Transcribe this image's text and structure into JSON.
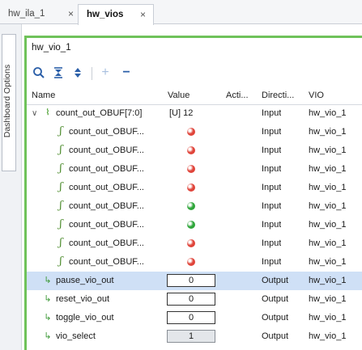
{
  "tabs": [
    {
      "label": "hw_ila_1",
      "close": "×",
      "active": false
    },
    {
      "label": "hw_vios",
      "close": "×",
      "active": true
    }
  ],
  "side_tab": "Dashboard Options",
  "panel": {
    "title": "hw_vio_1"
  },
  "toolbar": {
    "search": "⚲",
    "collapse_all": "⧖",
    "expand_all": "⬍",
    "add": "+",
    "remove": "−"
  },
  "columns": {
    "name": "Name",
    "value": "Value",
    "activity": "Acti...",
    "direction": "Directi...",
    "vio": "VIO"
  },
  "colors": {
    "green_led": "#2fa63a",
    "red_led": "#e0443a",
    "selection": "#cfe0f6",
    "panel_border": "#6fc25a"
  },
  "rows": [
    {
      "name": "count_out_OBUF[7:0]",
      "value": "[U] 12",
      "direction": "Input",
      "vio": "hw_vio_1",
      "icon": "bus-icon",
      "expander": "∨"
    },
    {
      "name": "count_out_OBUF...",
      "led": "red",
      "direction": "Input",
      "vio": "hw_vio_1",
      "icon": "wire-icon"
    },
    {
      "name": "count_out_OBUF...",
      "led": "red",
      "direction": "Input",
      "vio": "hw_vio_1",
      "icon": "wire-icon"
    },
    {
      "name": "count_out_OBUF...",
      "led": "red",
      "direction": "Input",
      "vio": "hw_vio_1",
      "icon": "wire-icon"
    },
    {
      "name": "count_out_OBUF...",
      "led": "red",
      "direction": "Input",
      "vio": "hw_vio_1",
      "icon": "wire-icon"
    },
    {
      "name": "count_out_OBUF...",
      "led": "green",
      "direction": "Input",
      "vio": "hw_vio_1",
      "icon": "wire-icon"
    },
    {
      "name": "count_out_OBUF...",
      "led": "green",
      "direction": "Input",
      "vio": "hw_vio_1",
      "icon": "wire-icon"
    },
    {
      "name": "count_out_OBUF...",
      "led": "red",
      "direction": "Input",
      "vio": "hw_vio_1",
      "icon": "wire-icon"
    },
    {
      "name": "count_out_OBUF...",
      "led": "red",
      "direction": "Input",
      "vio": "hw_vio_1",
      "icon": "wire-icon"
    },
    {
      "name": "pause_vio_out",
      "box": "0",
      "direction": "Output",
      "vio": "hw_vio_1",
      "icon": "output-probe-icon",
      "selected": true
    },
    {
      "name": "reset_vio_out",
      "box": "0",
      "direction": "Output",
      "vio": "hw_vio_1",
      "icon": "output-probe-icon"
    },
    {
      "name": "toggle_vio_out",
      "box": "0",
      "direction": "Output",
      "vio": "hw_vio_1",
      "icon": "output-probe-icon"
    },
    {
      "name": "vio_select",
      "box": "1",
      "box_gray": true,
      "direction": "Output",
      "vio": "hw_vio_1",
      "icon": "output-probe-icon"
    }
  ]
}
